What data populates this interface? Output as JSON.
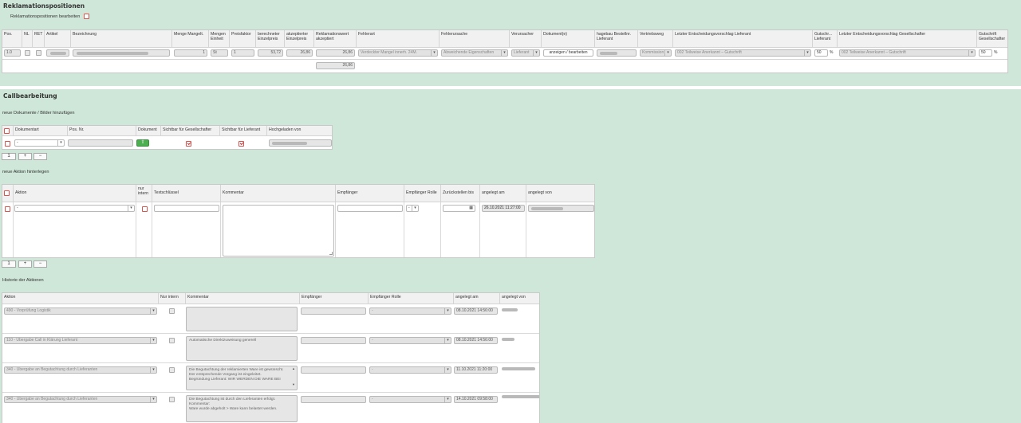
{
  "rek": {
    "title": "Reklamationspositionen",
    "edit_label": "Reklamationspositionen bearbeiten",
    "headers": [
      "Pos.",
      "NL",
      "RET",
      "Artikel",
      "Bezeichnung",
      "Menge Mangelt.",
      "Mengen Einheit",
      "Preisfaktor",
      "berechneter Einzelpreis",
      "akzeptierter Einzelpreis",
      "Reklamationswert akzeptiert",
      "Fehlerart",
      "Fehlerursache",
      "Verursacher",
      "Dokument(e)",
      "hagebau Bestellnr. Lieferant",
      "Vertriebsweg",
      "Letzter Entscheidungsvorschlag Lieferant",
      "Gutschr... Lieferant",
      "Letzter Entscheidungsvorschlag Gesellschafter",
      "Gutschrift Gesellschafter"
    ],
    "row": {
      "pos": "1.0",
      "menge": "1",
      "einheit": "St",
      "preisfaktor": "1",
      "berechnet": "53,72",
      "akzeptiert": "26,86",
      "wert": "26,86",
      "fehlerart": "Verdeckter Mangel innerh. 24M.",
      "fehlerursache": "Abweichende Eigenschaften",
      "verursacher": "Lieferant",
      "dokumente": "anzeigen / bearbeiten",
      "vertriebsweg": "Kommission",
      "vorschlag_lieferant": "002 Teilweise Anerkannt – Gutschrift",
      "gutschrift_lieferant": "50",
      "pct1": "%",
      "vorschlag_gesellschafter": "002 Teilweise Anerkannt – Gutschrift",
      "gutschrift_gesellschafter": "50",
      "pct2": "%"
    },
    "total": "26,86"
  },
  "call": {
    "title": "Callbearbeitung",
    "docs_title": "neue Dokumente / Bilder hinzufügen",
    "docs_headers": [
      "Dokumentart",
      "Pos. Nr.",
      "Dokument",
      "Sichtbar für Gesellschafter",
      "Sichtbar für Lieferant",
      "Hochgeladen von"
    ],
    "docs_row": {
      "dokumentart": "-"
    },
    "pager1": {
      "count": "1",
      "plus": "+",
      "minus": "−"
    },
    "action_title": "neue Aktion hinterlegen",
    "action_headers": [
      "Aktion",
      "nur intern",
      "Textschlüssel",
      "Kommentar",
      "Empfänger",
      "Empfänger Rolle",
      "Zurückstellen bis",
      "angelegt am",
      "angelegt von"
    ],
    "action_row": {
      "aktion": "-",
      "rolle": "-",
      "angelegt_am": "26.10.2021 11:27:00"
    },
    "pager2": {
      "count": "1",
      "plus": "+",
      "minus": "−"
    },
    "hist_title": "Historie der Aktionen",
    "hist_headers": [
      "Aktion",
      "Nur intern",
      "Kommentar",
      "Empfänger",
      "Empfänger Rolle",
      "angelegt am",
      "angelegt von"
    ],
    "hist_rows": [
      {
        "aktion": "490 - Vorprüfung Logistik",
        "kommentar": "",
        "rolle": "-",
        "am": "08.10.2021 14:56:00"
      },
      {
        "aktion": "110 - Übergabe Call in Klärung Lieferant",
        "kommentar": "Automatische Direktzuweisung generell",
        "rolle": "-",
        "am": "08.10.2021 14:56:00"
      },
      {
        "aktion": "340 - Übergabe an Begutachtung durch Lieferanten",
        "kommentar": "Die Begutachtung der reklamierten Ware ist gewünscht. Der entsprechende Vorgang ist eingeleitet.\nBegründung Lieferant: WIR WERDEN DIE WARE BEI",
        "rolle": "-",
        "am": "11.10.2021 11:20:00"
      },
      {
        "aktion": "340 - Übergabe an Begutachtung durch Lieferanten",
        "kommentar": "Die Begutachtung ist durch den Lieferanten erfolgt.\nKommentar:\nWare wurde abgeholt > Ware kann belastet werden.",
        "rolle": "-",
        "am": "14.10.2021 09:58:00"
      }
    ]
  }
}
